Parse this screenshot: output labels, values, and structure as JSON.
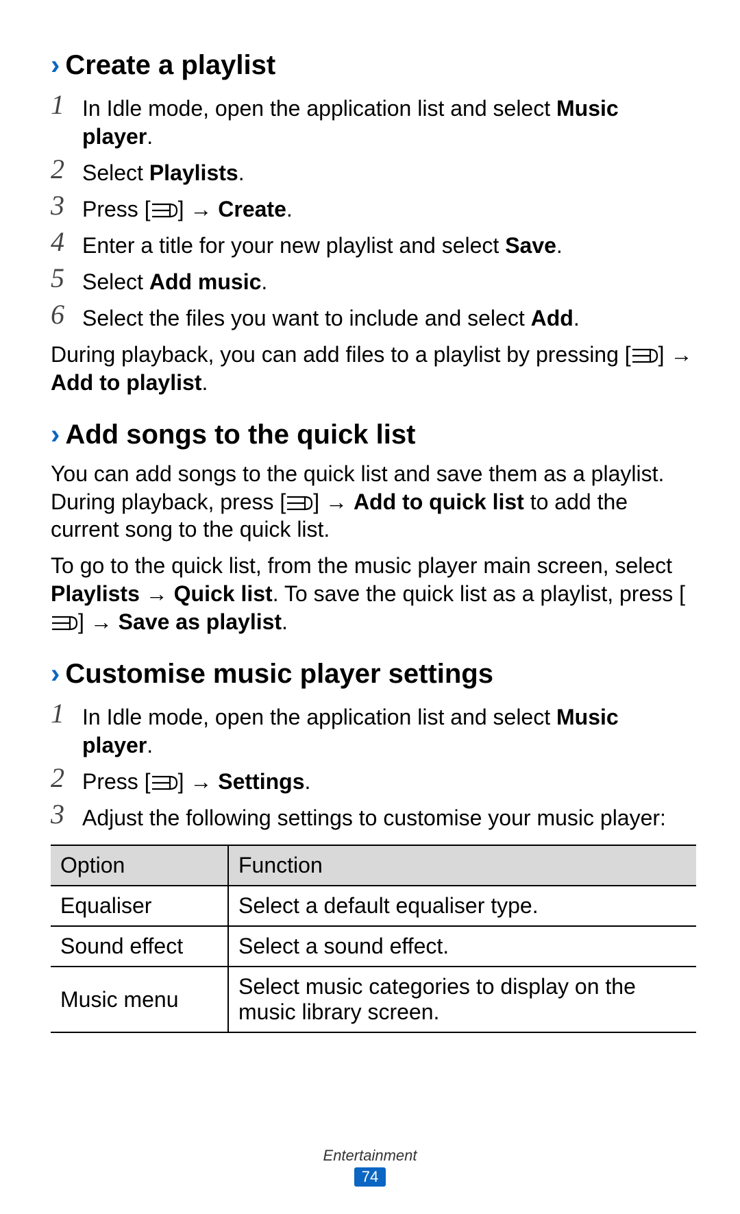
{
  "sections": {
    "createPlaylist": {
      "chevron": "›",
      "title": "Create a playlist",
      "steps": [
        {
          "n": "1",
          "parts": [
            "In Idle mode, open the application list and select ",
            {
              "b": "Music player"
            },
            "."
          ]
        },
        {
          "n": "2",
          "parts": [
            "Select ",
            {
              "b": "Playlists"
            },
            "."
          ]
        },
        {
          "n": "3",
          "parts": [
            "Press [",
            {
              "icon": "menu"
            },
            "] → ",
            {
              "b": "Create"
            },
            "."
          ]
        },
        {
          "n": "4",
          "parts": [
            "Enter a title for your new playlist and select ",
            {
              "b": "Save"
            },
            "."
          ]
        },
        {
          "n": "5",
          "parts": [
            "Select ",
            {
              "b": "Add music"
            },
            "."
          ]
        },
        {
          "n": "6",
          "parts": [
            "Select the files you want to include and select ",
            {
              "b": "Add"
            },
            "."
          ]
        }
      ],
      "after": {
        "parts": [
          "During playback, you can add files to a playlist by pressing [",
          {
            "icon": "menu"
          },
          "] → ",
          {
            "b": "Add to playlist"
          },
          "."
        ]
      }
    },
    "quickList": {
      "chevron": "›",
      "title": "Add songs to the quick list",
      "paras": [
        {
          "parts": [
            "You can add songs to the quick list and save them as a playlist. During playback, press [",
            {
              "icon": "menu"
            },
            "] → ",
            {
              "b": "Add to quick list"
            },
            " to add the current song to the quick list."
          ]
        },
        {
          "parts": [
            "To go to the quick list, from the music player main screen, select ",
            {
              "b": "Playlists"
            },
            " → ",
            {
              "b": "Quick list"
            },
            ". To save the quick list as a playlist, press [",
            {
              "icon": "menu"
            },
            "] → ",
            {
              "b": "Save as playlist"
            },
            "."
          ]
        }
      ]
    },
    "customise": {
      "chevron": "›",
      "title": "Customise music player settings",
      "steps": [
        {
          "n": "1",
          "parts": [
            "In Idle mode, open the application list and select ",
            {
              "b": "Music player"
            },
            "."
          ]
        },
        {
          "n": "2",
          "parts": [
            "Press [",
            {
              "icon": "menu"
            },
            "] → ",
            {
              "b": "Settings"
            },
            "."
          ]
        },
        {
          "n": "3",
          "parts": [
            "Adjust the following settings to customise your music player:"
          ]
        }
      ]
    }
  },
  "table": {
    "headers": [
      "Option",
      "Function"
    ],
    "rows": [
      [
        "Equaliser",
        "Select a default equaliser type."
      ],
      [
        "Sound effect",
        "Select a sound effect."
      ],
      [
        "Music menu",
        "Select music categories to display on the music library screen."
      ]
    ]
  },
  "footer": {
    "section": "Entertainment",
    "page": "74"
  }
}
